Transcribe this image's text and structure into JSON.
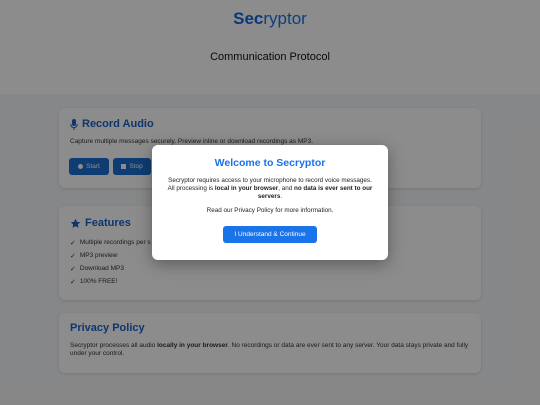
{
  "header": {
    "brand_bold": "Sec",
    "brand_rest": "ryptor",
    "subtitle": "Communication Protocol"
  },
  "record_card": {
    "title": "Record Audio",
    "icon": "microphone-icon",
    "description": "Capture multiple messages securely. Preview inline or download recordings as MP3.",
    "start_label": "Start",
    "stop_label": "Stop"
  },
  "features_card": {
    "title": "Features",
    "icon": "star-icon",
    "items": [
      "Multiple recordings per s",
      "MP3 preview",
      "Download MP3",
      "100% FREE!"
    ]
  },
  "privacy_card": {
    "title": "Privacy Policy",
    "text_prefix": "Secryptor processes all audio ",
    "text_bold": "locally in your browser",
    "text_suffix": ". No recordings or data are ever sent to any server. Your data stays private and fully under your control."
  },
  "modal": {
    "title": "Welcome to Secryptor",
    "body_1": "Secryptor requires access to your microphone to record voice messages. All processing is ",
    "body_bold_1": "local in your browser",
    "body_2": ", and ",
    "body_bold_2": "no data is ever sent to our servers",
    "body_3": ".",
    "note": "Read our Privacy Policy for more information.",
    "button_label": "I Understand & Continue"
  },
  "colors": {
    "accent": "#1a73e8",
    "button": "#1a6fd1",
    "overlay": "rgba(0,0,0,0.45)"
  }
}
